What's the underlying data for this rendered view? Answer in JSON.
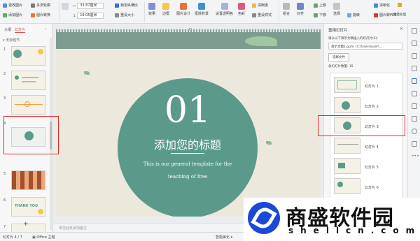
{
  "ribbon": {
    "change_pic": "更改图片",
    "add_pic": "添加图片",
    "multi_crop": "多页轮廓",
    "pic_convert": "图片转换",
    "width_val": "33.87厘米",
    "height_val": "19.05厘米",
    "lock_ratio": "锁定纵横比",
    "reset_size": "重设大小",
    "effects": "效果",
    "border": "边框",
    "pic_design": "图片设计",
    "remove_bg": "抠除背景",
    "set_transparent": "设置透明色",
    "color": "色彩",
    "brightness": "清晰度",
    "reset_style": "重设样式",
    "combine": "组合",
    "align": "对齐",
    "up_layer": "上移",
    "down_layer": "下移",
    "select": "选择",
    "rotate": "旋转",
    "batch_process": "批量处理",
    "clarify": "清晰化",
    "pic_to_pdf": "图片转PDF"
  },
  "left_panel": {
    "tab_outline": "大纲",
    "tab_slides": "幻灯片",
    "section": "无标题节",
    "numbers": [
      "1",
      "2",
      "3",
      "4",
      "5",
      "6",
      "7"
    ],
    "thank_you": "THANK YOU",
    "add_btn": "+"
  },
  "slide": {
    "big_number": "01",
    "title": "添加您的标题",
    "subtitle_1": "This is our general template for the",
    "subtitle_2": "teaching of free"
  },
  "notes_placeholder": "单击此处添加备注",
  "status": {
    "slide_count": "幻灯片 4 / 7",
    "theme": "Office 主题",
    "beautify": "智能美化"
  },
  "right_panel": {
    "title": "重用幻灯片",
    "instruction": "请从以下演示文稿插入的幻灯片(S):",
    "file_path": "演示文稿1.pptx（C:\\Users\\user\\...",
    "browse_btn": "选择文件",
    "count_label": "总幻灯片数量: 15",
    "items": [
      "幻灯片 1",
      "幻灯片 2",
      "幻灯片 3",
      "幻灯片 4",
      "幻灯片 5",
      "幻灯片 6"
    ]
  },
  "watermark": {
    "name": "商盛软件园",
    "url": "shellcn.com"
  },
  "colors": {
    "accent": "#5b9a8b",
    "highlight": "#e02a2a",
    "slide_bg": "#ece9dc"
  }
}
